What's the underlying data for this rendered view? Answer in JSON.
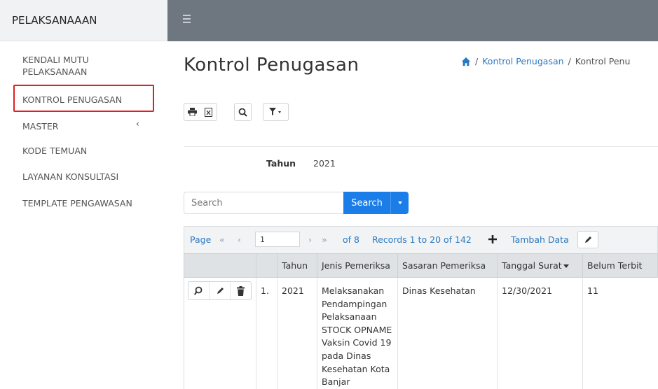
{
  "sidebar": {
    "title": "PELAKSANAAAN",
    "items": [
      {
        "label": "KENDALI MUTU\nPELAKSANAAN"
      },
      {
        "label": "KONTROL PENUGASAN"
      },
      {
        "label": "MASTER"
      },
      {
        "label": "KODE TEMUAN"
      },
      {
        "label": "LAYANAN KONSULTASI"
      },
      {
        "label": "TEMPLATE PENGAWASAN"
      }
    ],
    "master_caret": "‹"
  },
  "header": {
    "page_title": "Kontrol Penugasan",
    "breadcrumb": {
      "sep": "/",
      "link": "Kontrol Penugasan",
      "current": "Kontrol Penu"
    }
  },
  "toolbar": {
    "icons": [
      "print-icon",
      "excel-icon",
      "search-icon",
      "filter-icon"
    ]
  },
  "filter": {
    "tahun_label": "Tahun",
    "tahun_value": "2021"
  },
  "search": {
    "placeholder": "Search",
    "button_label": "Search"
  },
  "pager": {
    "page_label": "Page",
    "first": "«",
    "prev": "‹",
    "current_page": "1",
    "next": "›",
    "last": "»",
    "of_pages": "of 8",
    "records": "Records 1 to 20 of 142",
    "add_label": "Tambah Data"
  },
  "table": {
    "columns": [
      "",
      "",
      "Tahun",
      "Jenis Pemeriksa",
      "Sasaran Pemeriksa",
      "Tanggal Surat",
      "Belum Terbit"
    ],
    "rows": [
      {
        "no": "1.",
        "tahun": "2021",
        "jenis": "Melaksanakan\nPendampingan\nPelaksanaan\nSTOCK OPNAME\nVaksin Covid 19\npada Dinas\nKesehatan Kota\nBanjar",
        "sasaran": "Dinas Kesehatan",
        "tanggal": "12/30/2021",
        "belum": "11"
      }
    ]
  },
  "colors": {
    "accent": "#1a7de8",
    "topbar": "#6e7780",
    "highlight": "#e02020",
    "link": "#2a7ac2"
  }
}
